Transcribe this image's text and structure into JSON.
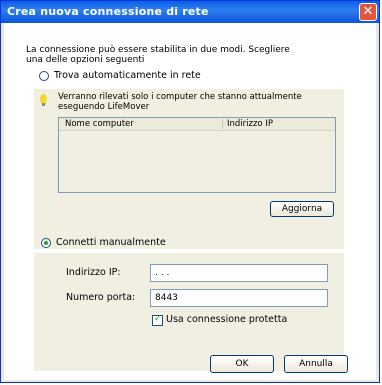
{
  "window": {
    "title": "Crea nuova connessione di rete",
    "close_label": "✕"
  },
  "intro": "La connessione può essere stabilita in due modi. Scegliere una delle opzioni seguenti",
  "auto": {
    "radio_label": "Trova automaticamente in rete",
    "note": "Verranno rilevati solo i computer che stanno attualmente eseguendo LifeMover",
    "columns": [
      "Nome computer",
      "Indirizzo IP"
    ],
    "refresh_label": "Aggiorna"
  },
  "manual": {
    "radio_label": "Connetti manualmente",
    "ip_label": "Indirizzo IP:",
    "ip_value": ". . .",
    "port_label": "Numero porta:",
    "port_value": "8443",
    "secure_label": "Usa connessione protetta"
  },
  "buttons": {
    "ok": "OK",
    "cancel": "Annulla"
  }
}
